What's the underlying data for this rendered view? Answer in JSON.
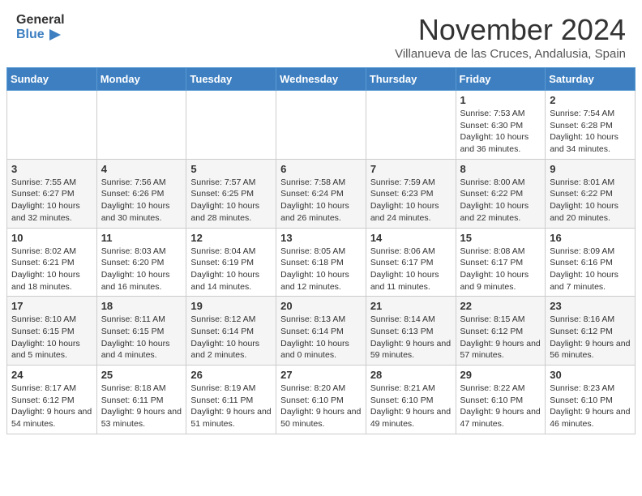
{
  "header": {
    "logo_line1": "General",
    "logo_line2": "Blue",
    "month": "November 2024",
    "location": "Villanueva de las Cruces, Andalusia, Spain"
  },
  "weekdays": [
    "Sunday",
    "Monday",
    "Tuesday",
    "Wednesday",
    "Thursday",
    "Friday",
    "Saturday"
  ],
  "weeks": [
    [
      {
        "day": "",
        "info": ""
      },
      {
        "day": "",
        "info": ""
      },
      {
        "day": "",
        "info": ""
      },
      {
        "day": "",
        "info": ""
      },
      {
        "day": "",
        "info": ""
      },
      {
        "day": "1",
        "info": "Sunrise: 7:53 AM\nSunset: 6:30 PM\nDaylight: 10 hours and 36 minutes."
      },
      {
        "day": "2",
        "info": "Sunrise: 7:54 AM\nSunset: 6:28 PM\nDaylight: 10 hours and 34 minutes."
      }
    ],
    [
      {
        "day": "3",
        "info": "Sunrise: 7:55 AM\nSunset: 6:27 PM\nDaylight: 10 hours and 32 minutes."
      },
      {
        "day": "4",
        "info": "Sunrise: 7:56 AM\nSunset: 6:26 PM\nDaylight: 10 hours and 30 minutes."
      },
      {
        "day": "5",
        "info": "Sunrise: 7:57 AM\nSunset: 6:25 PM\nDaylight: 10 hours and 28 minutes."
      },
      {
        "day": "6",
        "info": "Sunrise: 7:58 AM\nSunset: 6:24 PM\nDaylight: 10 hours and 26 minutes."
      },
      {
        "day": "7",
        "info": "Sunrise: 7:59 AM\nSunset: 6:23 PM\nDaylight: 10 hours and 24 minutes."
      },
      {
        "day": "8",
        "info": "Sunrise: 8:00 AM\nSunset: 6:22 PM\nDaylight: 10 hours and 22 minutes."
      },
      {
        "day": "9",
        "info": "Sunrise: 8:01 AM\nSunset: 6:22 PM\nDaylight: 10 hours and 20 minutes."
      }
    ],
    [
      {
        "day": "10",
        "info": "Sunrise: 8:02 AM\nSunset: 6:21 PM\nDaylight: 10 hours and 18 minutes."
      },
      {
        "day": "11",
        "info": "Sunrise: 8:03 AM\nSunset: 6:20 PM\nDaylight: 10 hours and 16 minutes."
      },
      {
        "day": "12",
        "info": "Sunrise: 8:04 AM\nSunset: 6:19 PM\nDaylight: 10 hours and 14 minutes."
      },
      {
        "day": "13",
        "info": "Sunrise: 8:05 AM\nSunset: 6:18 PM\nDaylight: 10 hours and 12 minutes."
      },
      {
        "day": "14",
        "info": "Sunrise: 8:06 AM\nSunset: 6:17 PM\nDaylight: 10 hours and 11 minutes."
      },
      {
        "day": "15",
        "info": "Sunrise: 8:08 AM\nSunset: 6:17 PM\nDaylight: 10 hours and 9 minutes."
      },
      {
        "day": "16",
        "info": "Sunrise: 8:09 AM\nSunset: 6:16 PM\nDaylight: 10 hours and 7 minutes."
      }
    ],
    [
      {
        "day": "17",
        "info": "Sunrise: 8:10 AM\nSunset: 6:15 PM\nDaylight: 10 hours and 5 minutes."
      },
      {
        "day": "18",
        "info": "Sunrise: 8:11 AM\nSunset: 6:15 PM\nDaylight: 10 hours and 4 minutes."
      },
      {
        "day": "19",
        "info": "Sunrise: 8:12 AM\nSunset: 6:14 PM\nDaylight: 10 hours and 2 minutes."
      },
      {
        "day": "20",
        "info": "Sunrise: 8:13 AM\nSunset: 6:14 PM\nDaylight: 10 hours and 0 minutes."
      },
      {
        "day": "21",
        "info": "Sunrise: 8:14 AM\nSunset: 6:13 PM\nDaylight: 9 hours and 59 minutes."
      },
      {
        "day": "22",
        "info": "Sunrise: 8:15 AM\nSunset: 6:12 PM\nDaylight: 9 hours and 57 minutes."
      },
      {
        "day": "23",
        "info": "Sunrise: 8:16 AM\nSunset: 6:12 PM\nDaylight: 9 hours and 56 minutes."
      }
    ],
    [
      {
        "day": "24",
        "info": "Sunrise: 8:17 AM\nSunset: 6:12 PM\nDaylight: 9 hours and 54 minutes."
      },
      {
        "day": "25",
        "info": "Sunrise: 8:18 AM\nSunset: 6:11 PM\nDaylight: 9 hours and 53 minutes."
      },
      {
        "day": "26",
        "info": "Sunrise: 8:19 AM\nSunset: 6:11 PM\nDaylight: 9 hours and 51 minutes."
      },
      {
        "day": "27",
        "info": "Sunrise: 8:20 AM\nSunset: 6:10 PM\nDaylight: 9 hours and 50 minutes."
      },
      {
        "day": "28",
        "info": "Sunrise: 8:21 AM\nSunset: 6:10 PM\nDaylight: 9 hours and 49 minutes."
      },
      {
        "day": "29",
        "info": "Sunrise: 8:22 AM\nSunset: 6:10 PM\nDaylight: 9 hours and 47 minutes."
      },
      {
        "day": "30",
        "info": "Sunrise: 8:23 AM\nSunset: 6:10 PM\nDaylight: 9 hours and 46 minutes."
      }
    ]
  ]
}
